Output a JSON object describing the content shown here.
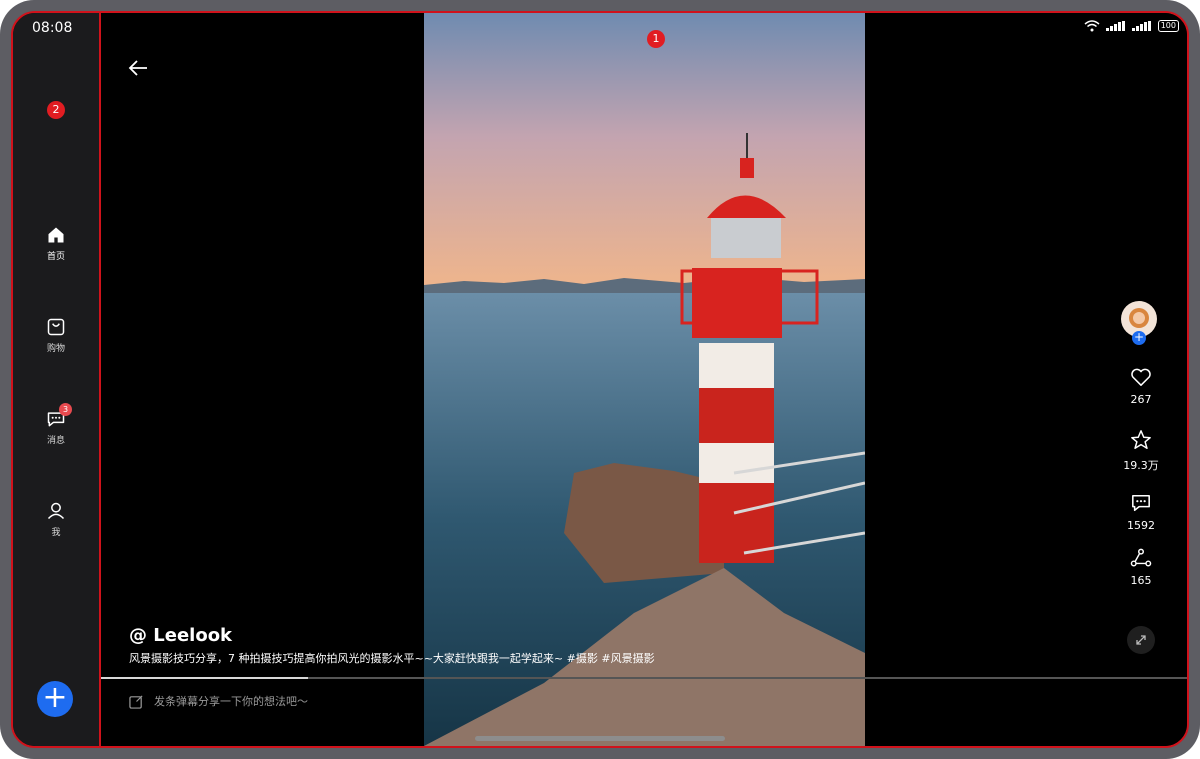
{
  "status": {
    "time": "08:08",
    "battery": "100"
  },
  "markers": {
    "screen_marker": "1",
    "sidebar_marker": "2"
  },
  "sidebar": {
    "items": [
      {
        "label": "首页",
        "icon": "home-icon"
      },
      {
        "label": "购物",
        "icon": "shopping-bag-icon"
      },
      {
        "label": "消息",
        "icon": "message-icon",
        "badge": "3"
      },
      {
        "label": "我",
        "icon": "profile-icon"
      }
    ],
    "fab": "+"
  },
  "video": {
    "author": "@ Leelook",
    "caption": "风景摄影技巧分享，7 种拍摄技巧提高你拍风光的摄影水平~~大家赶快跟我一起学起来~ #摄影  #风景摄影",
    "progress": 0.19
  },
  "actions": {
    "likes": "267",
    "favorites": "19.3万",
    "comments": "1592",
    "shares": "165"
  },
  "danmaku": {
    "placeholder": "发条弹幕分享一下你的想法吧～"
  },
  "colors": {
    "accent": "#1e6cf0",
    "badge": "#e11d22",
    "frame": "#d0121b"
  }
}
